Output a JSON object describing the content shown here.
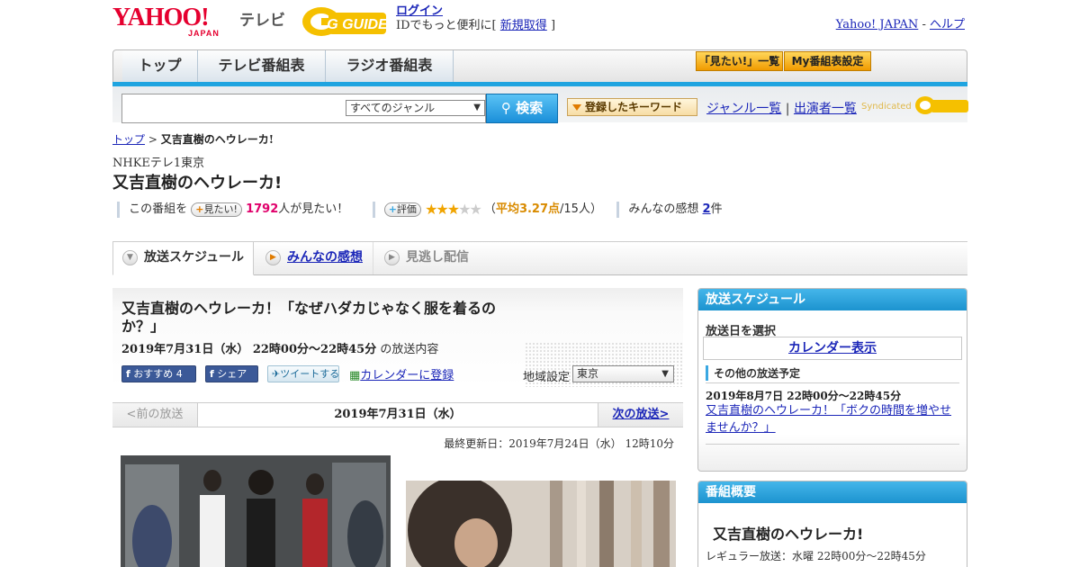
{
  "header": {
    "logo_yahoo": "YAHOO!",
    "logo_japan": "JAPAN",
    "tv_label": "テレビ",
    "gguide_logo": "G GUIDE",
    "login": "ログイン",
    "login_desc": "IDでもっと便利に[",
    "signup": "新規取得",
    "bracket_close": "]",
    "yahoo_japan_link": "Yahoo! JAPAN",
    "sep": "-",
    "help_link": "ヘルプ"
  },
  "nav": {
    "tabs": [
      {
        "label": "トップ"
      },
      {
        "label": "テレビ番組表"
      },
      {
        "label": "ラジオ番組表"
      }
    ],
    "mitai_list": "「見たい!」一覧",
    "my_schedule": "My番組表設定"
  },
  "search": {
    "placeholder": "",
    "genre_selected": "すべてのジャンル",
    "search_button": "検索",
    "keyword_button": "登録したキーワード",
    "genre_list_link": "ジャンル一覧",
    "divider": "|",
    "performer_link": "出演者一覧",
    "syndicated": "Syndicated"
  },
  "breadcrumb": {
    "top": "トップ",
    "sep": ">",
    "current": "又吉直樹のヘウレーカ!"
  },
  "program": {
    "channel": "NHKEテレ1東京",
    "title": "又吉直樹のヘウレーカ!",
    "stats": {
      "this_program_prefix": "この番組を",
      "mitai_button": "見たい!",
      "mitai_count": "1792",
      "mitai_suffix": "人が見たい！",
      "rate_button": "評価",
      "rating": 3,
      "rating_max": 5,
      "avg_open": "（",
      "avg_label": "平均3.27点",
      "avg_count": "/15人）",
      "review_label": "みんなの感想",
      "review_count": "2",
      "review_unit": "件"
    }
  },
  "subtabs": [
    {
      "label": "放送スケジュール"
    },
    {
      "label": "みんなの感想"
    },
    {
      "label": "見逃し配信"
    }
  ],
  "article": {
    "title": "又吉直樹のヘウレーカ！「なぜハダカじゃなく服を着るのか？」",
    "date": "2019年7月31日（水） 22時00分～22時45分",
    "date_suffix": "の放送内容",
    "share": {
      "fb_recommend": "おすすめ 4",
      "fb_share": "シェア",
      "tweet": "ツイートする",
      "calendar": "カレンダーに登録"
    },
    "region_label": "地域設定",
    "region_value": "東京",
    "paging": {
      "prev": "<前の放送",
      "current": "2019年7月31日（水）",
      "next": "次の放送>"
    },
    "updated": "最終更新日：2019年7月24日（水） 12時10分"
  },
  "sidebar": {
    "schedule": {
      "title": "放送スケジュール",
      "select_label": "放送日を選択",
      "calendar_link": "カレンダー表示",
      "other_label": "その他の放送予定",
      "other_date": "2019年8月7日 22時00分～22時45分",
      "other_link": "又吉直樹のヘウレーカ！「ボクの時間を増やせませんか？」"
    },
    "summary": {
      "title": "番組概要",
      "program": "又吉直樹のヘウレーカ!",
      "regular": "レギュラー放送：水曜 22時00分～22時45分"
    }
  },
  "colors": {
    "accent_blue": "#1fa4e0",
    "yahoo_red": "#e5002f",
    "link": "#1b26b8",
    "star": "#f0a400",
    "mitai_pink": "#e0006b"
  }
}
